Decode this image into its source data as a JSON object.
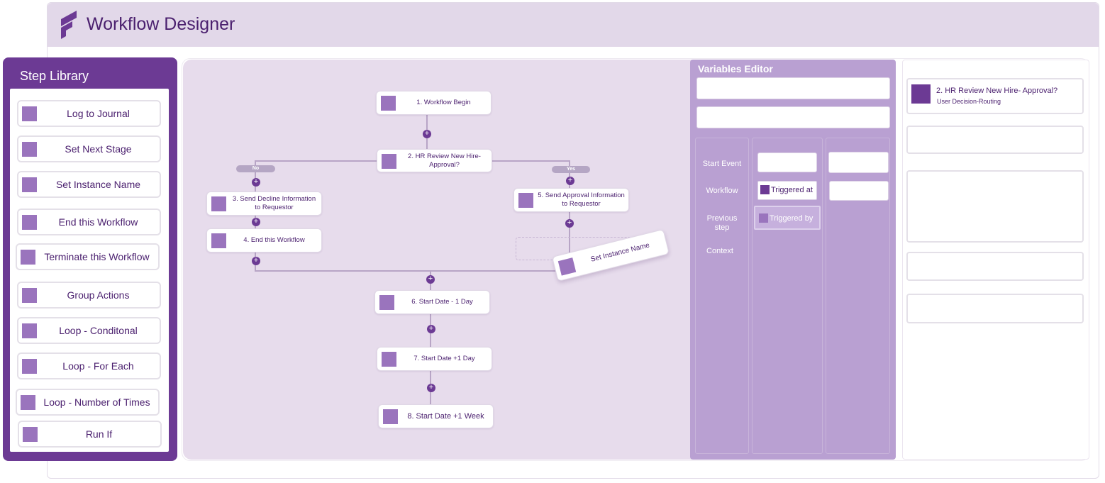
{
  "app": {
    "title": "Workflow Designer"
  },
  "step_library": {
    "title": "Step Library",
    "items": [
      "Log to Journal",
      "Set Next Stage",
      "Set Instance Name",
      "End this Workflow",
      "Terminate this Workflow",
      "Group Actions",
      "Loop - Conditonal",
      "Loop - For Each",
      "Loop - Number of Times",
      "Run If"
    ]
  },
  "canvas": {
    "nodes": {
      "n1": "1.  Workflow Begin",
      "n2": "2. HR Review New Hire- Approval?",
      "n3": "3. Send Decline Information to Requestor",
      "n4": "4. End this Workflow",
      "n5": "5. Send Approval Information to Requestor",
      "n6": "6. Start Date - 1 Day",
      "n7": "7. Start Date +1 Day",
      "n8": "8. Start Date +1 Week"
    },
    "branch_no": "No",
    "branch_yes": "Yes",
    "plus_symbol": "+",
    "dragging_item": "Set Instance Name"
  },
  "variables_editor": {
    "title": "Variables Editor",
    "row_labels": [
      "Start Event",
      "Workflow",
      "Previous step",
      "Context"
    ],
    "chips": {
      "triggered_at": "Triggered at",
      "triggered_by": "Triggered by"
    }
  },
  "properties": {
    "step_title": "2. HR Review New Hire- Approval?",
    "step_subtitle": "User Decision-Routing"
  },
  "colors": {
    "brand_purple": "#6c3a94",
    "light_purple": "#e2d8e9",
    "canvas_bg": "#e7dcec",
    "variables_bg": "#b9a0d2",
    "step_square": "#9a74bd"
  }
}
